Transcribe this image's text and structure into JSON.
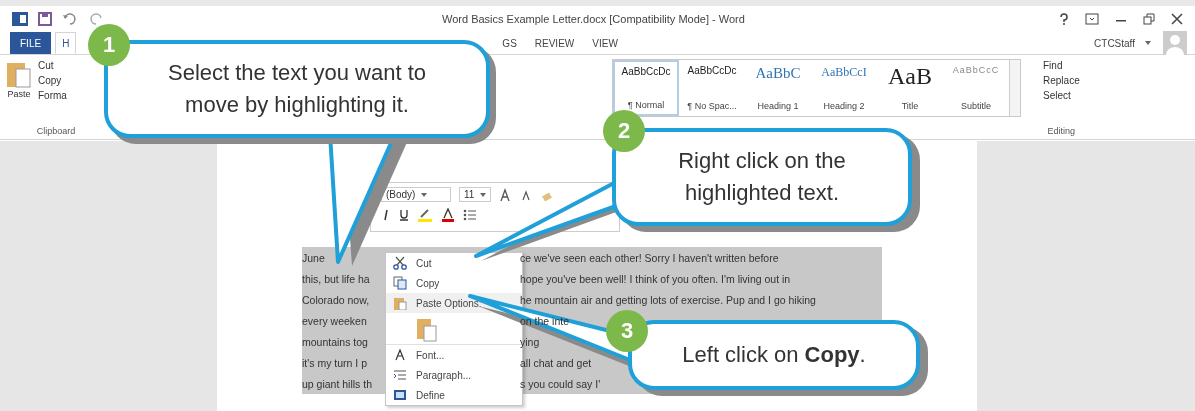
{
  "window": {
    "title": "Word Basics Example Letter.docx [Compatibility Mode] - Word",
    "user": "CTCStaff"
  },
  "tabs": [
    {
      "label": "FILE",
      "kind": "file",
      "selected": false
    },
    {
      "label": "H",
      "kind": "tab",
      "selected": true
    },
    {
      "label": "GS",
      "kind": "tab",
      "selected": false
    },
    {
      "label": "REVIEW",
      "kind": "tab",
      "selected": false
    },
    {
      "label": "VIEW",
      "kind": "tab",
      "selected": false
    }
  ],
  "clipboard": {
    "paste": "Paste",
    "items": [
      "Cut",
      "Copy",
      "Forma"
    ],
    "group": "Clipboard"
  },
  "styles": [
    {
      "preview": "AaBbCcDc",
      "name": "¶ Normal",
      "kind": "normal",
      "selected": true
    },
    {
      "preview": "AaBbCcDc",
      "name": "¶ No Spac...",
      "kind": "normal",
      "selected": false
    },
    {
      "preview": "AaBbC",
      "name": "Heading 1",
      "kind": "heading1",
      "selected": false
    },
    {
      "preview": "AaBbCcI",
      "name": "Heading 2",
      "kind": "heading2",
      "selected": false
    },
    {
      "preview": "AaB",
      "name": "Title",
      "kind": "title",
      "selected": false
    },
    {
      "preview": "AaBbCcC",
      "name": "Subtitle",
      "kind": "subtitle",
      "selected": false
    }
  ],
  "editing": {
    "items": [
      "Find",
      "Replace",
      "Select"
    ],
    "group": "Editing"
  },
  "mini_toolbar": {
    "font": "(Body)",
    "size": "11"
  },
  "document_lines": [
    {
      "left": "June",
      "right": "ce we've seen each other!  Sorry I haven't written before"
    },
    {
      "left": "this, but life ha",
      "right": "hope you've been well!  I think of you often.  I'm living out in"
    },
    {
      "left": "Colorado now,",
      "right": "he mountain air and getting lots of exercise.  Pup and I go hiking"
    },
    {
      "left": "every weeken",
      "right": "on the inte"
    },
    {
      "left": "mountains tog",
      "right": "ying"
    },
    {
      "left": "it's my turn I p",
      "right": "all chat and get"
    },
    {
      "left": "up giant hills th",
      "right": "s you could say I'"
    }
  ],
  "context_menu": [
    {
      "label": "Cut",
      "kind": "item"
    },
    {
      "label": "Copy",
      "kind": "item"
    },
    {
      "label": "Paste Options:",
      "kind": "header"
    },
    {
      "kind": "paste"
    },
    {
      "label": "Font...",
      "kind": "item"
    },
    {
      "label": "Paragraph...",
      "kind": "item"
    },
    {
      "label": "Define",
      "kind": "item"
    }
  ],
  "callouts": [
    {
      "number": "1",
      "text": "Select the text you want to move by highlighting it."
    },
    {
      "number": "2",
      "text": "Right click on the highlighted text."
    },
    {
      "number": "3",
      "text": "Left click on **Copy**."
    }
  ]
}
